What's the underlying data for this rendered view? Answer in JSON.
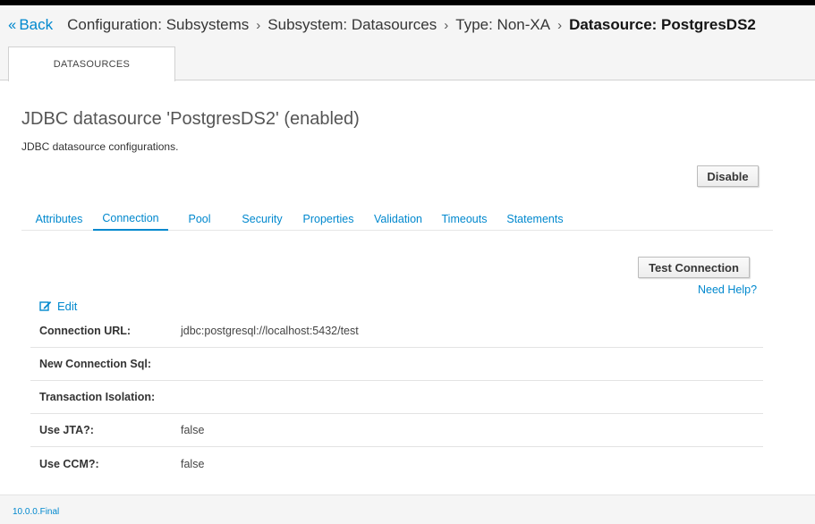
{
  "breadcrumb": {
    "back_label": "Back",
    "items": [
      "Configuration: Subsystems",
      "Subsystem: Datasources",
      "Type: Non-XA",
      "Datasource: PostgresDS2"
    ]
  },
  "main_tab": {
    "label": "DATASOURCES"
  },
  "page": {
    "title": "JDBC datasource 'PostgresDS2' (enabled)",
    "description": "JDBC datasource configurations.",
    "disable_label": "Disable"
  },
  "subtabs": [
    {
      "label": "Attributes",
      "active": false
    },
    {
      "label": "Connection",
      "active": true
    },
    {
      "label": "Pool",
      "active": false
    },
    {
      "label": "Security",
      "active": false
    },
    {
      "label": "Properties",
      "active": false
    },
    {
      "label": "Validation",
      "active": false
    },
    {
      "label": "Timeouts",
      "active": false
    },
    {
      "label": "Statements",
      "active": false
    }
  ],
  "connection": {
    "test_label": "Test Connection",
    "help_label": "Need Help?",
    "edit_label": "Edit",
    "attributes": [
      {
        "label": "Connection URL:",
        "value": "jdbc:postgresql://localhost:5432/test"
      },
      {
        "label": "New Connection Sql:",
        "value": ""
      },
      {
        "label": "Transaction Isolation:",
        "value": ""
      },
      {
        "label": "Use JTA?:",
        "value": "false"
      },
      {
        "label": "Use CCM?:",
        "value": "false"
      }
    ]
  },
  "footer": {
    "version": "10.0.0.Final"
  },
  "colors": {
    "link": "#0088ce",
    "topbar": "#000000",
    "header_bg": "#f5f5f5"
  }
}
